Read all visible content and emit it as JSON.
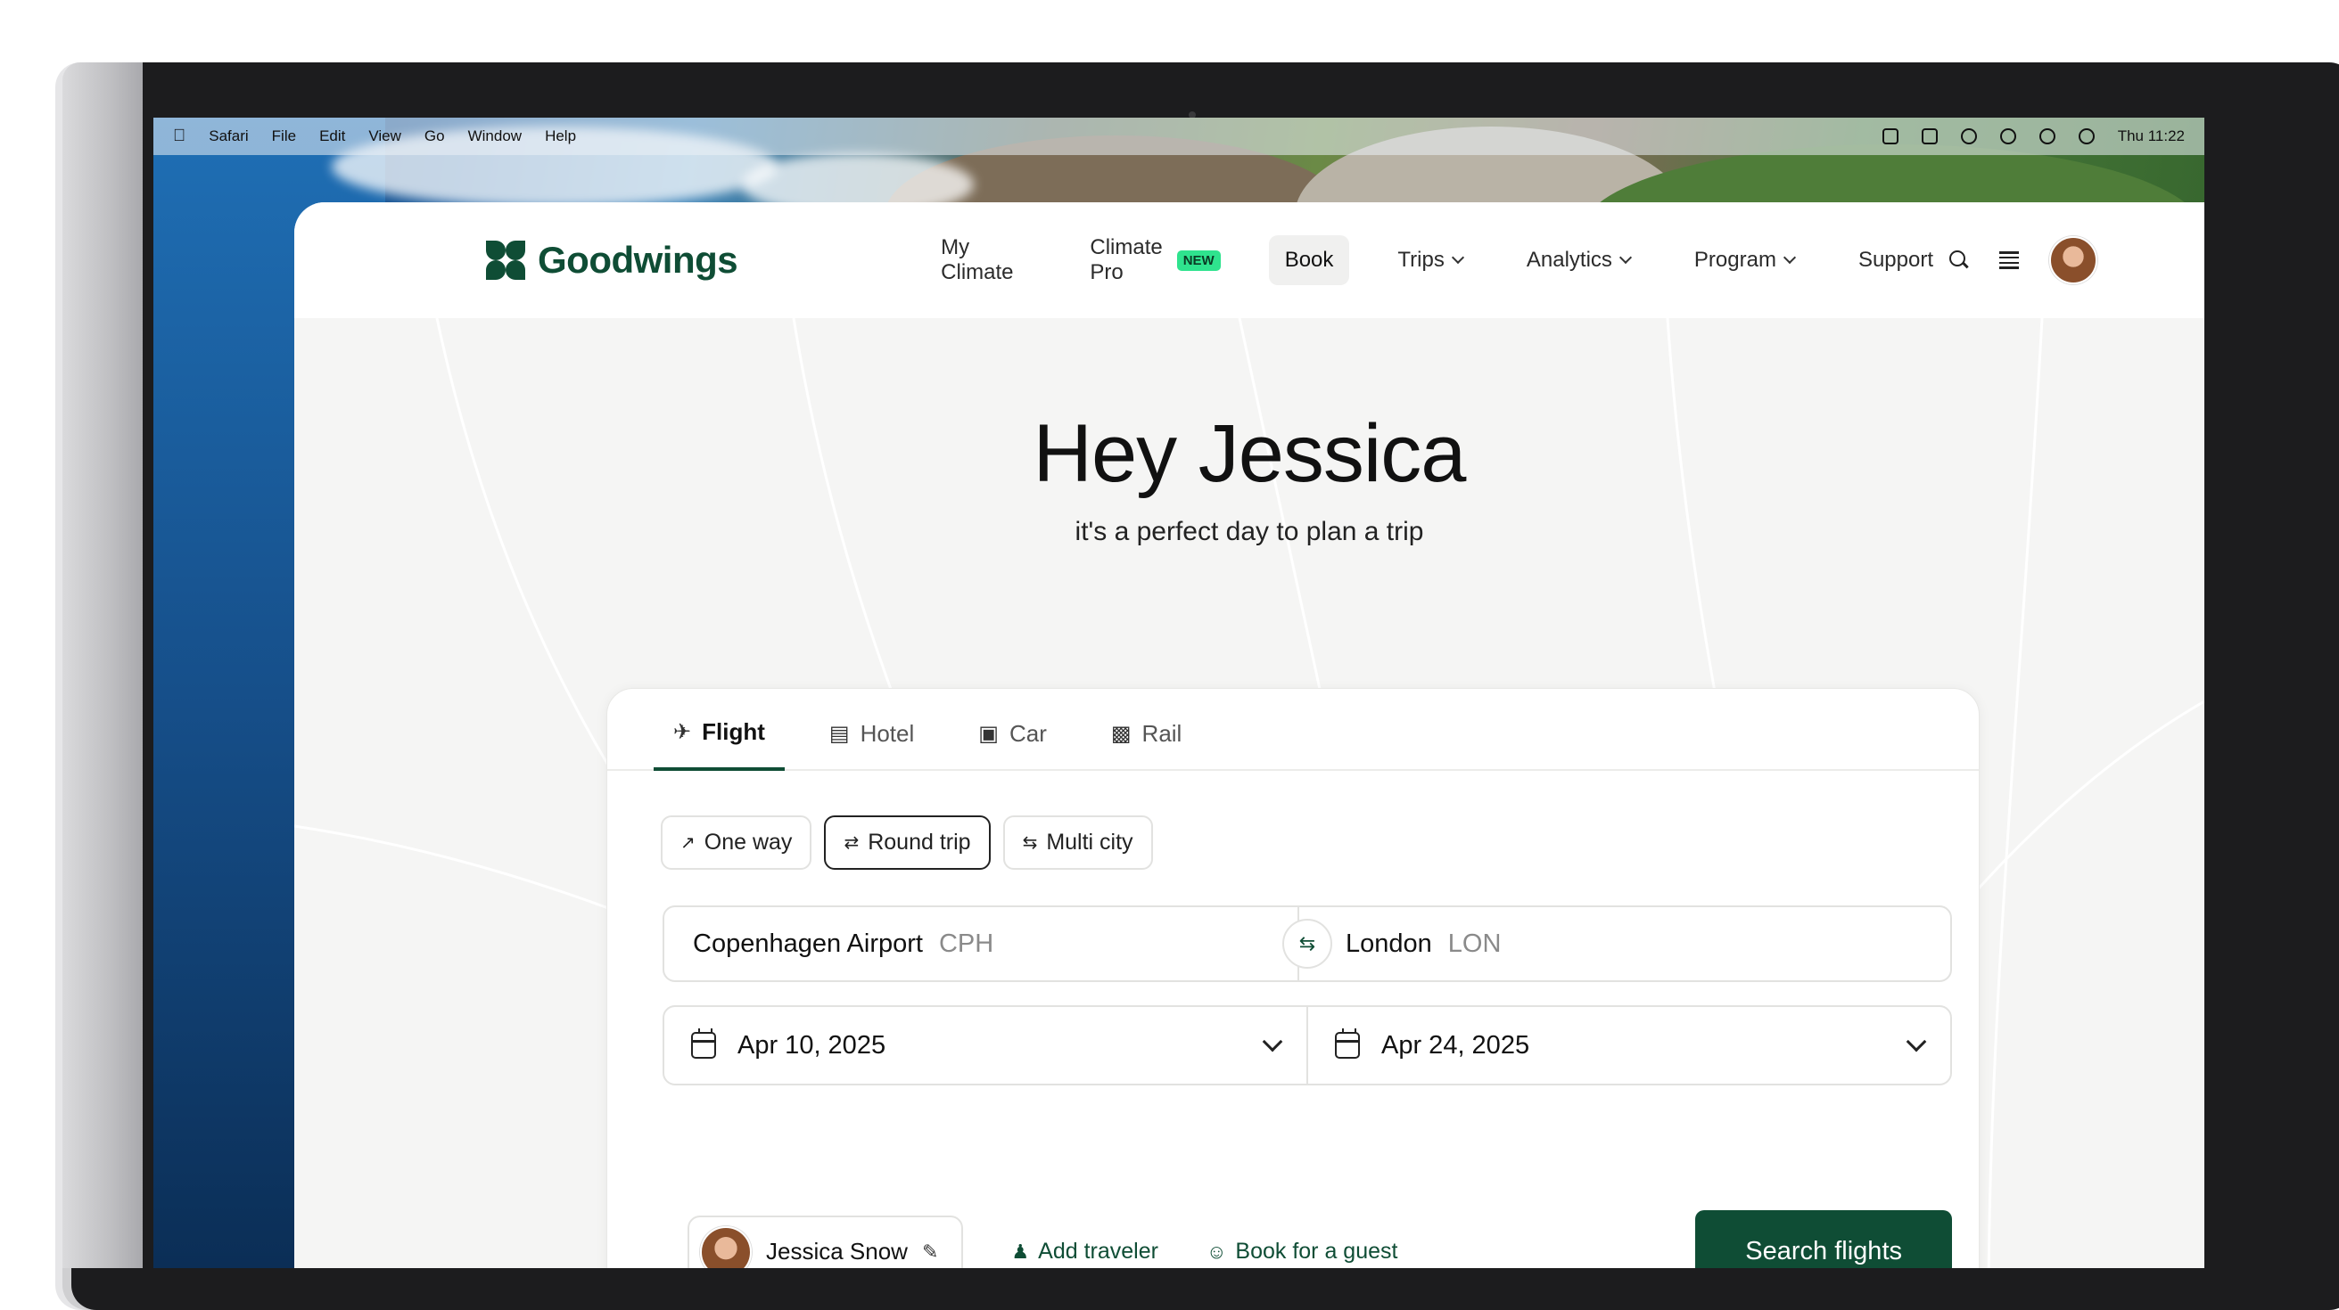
{
  "menubar": {
    "items": [
      "Safari",
      "File",
      "Edit",
      "View",
      "Go",
      "Window",
      "Help"
    ],
    "clock": "Thu 11:22"
  },
  "app": {
    "logo_text": "Goodwings",
    "nav": {
      "my_climate": "My Climate",
      "climate_pro": "Climate Pro",
      "climate_pro_badge": "NEW",
      "book": "Book",
      "trips": "Trips",
      "analytics": "Analytics",
      "program": "Program",
      "support": "Support"
    }
  },
  "hero": {
    "greeting": "Hey Jessica",
    "subtitle": "it's a perfect day to plan a trip"
  },
  "booking": {
    "tabs": [
      {
        "label": "Flight",
        "icon": "plane-icon"
      },
      {
        "label": "Hotel",
        "icon": "bed-icon"
      },
      {
        "label": "Car",
        "icon": "car-icon"
      },
      {
        "label": "Rail",
        "icon": "train-icon"
      }
    ],
    "active_tab": "Flight",
    "trip_types": [
      "One way",
      "Round trip",
      "Multi city"
    ],
    "selected_trip_type": "Round trip",
    "origin": {
      "name": "Copenhagen Airport",
      "code": "CPH"
    },
    "destination": {
      "name": "London",
      "code": "LON"
    },
    "depart_date": "Apr 10, 2025",
    "return_date": "Apr 24, 2025",
    "traveler_name": "Jessica Snow",
    "add_traveler": "Add traveler",
    "book_for_guest": "Book for a guest",
    "search_button": "Search flights"
  },
  "colors": {
    "brand": "#0f4d35",
    "badge": "#2fe38e"
  }
}
